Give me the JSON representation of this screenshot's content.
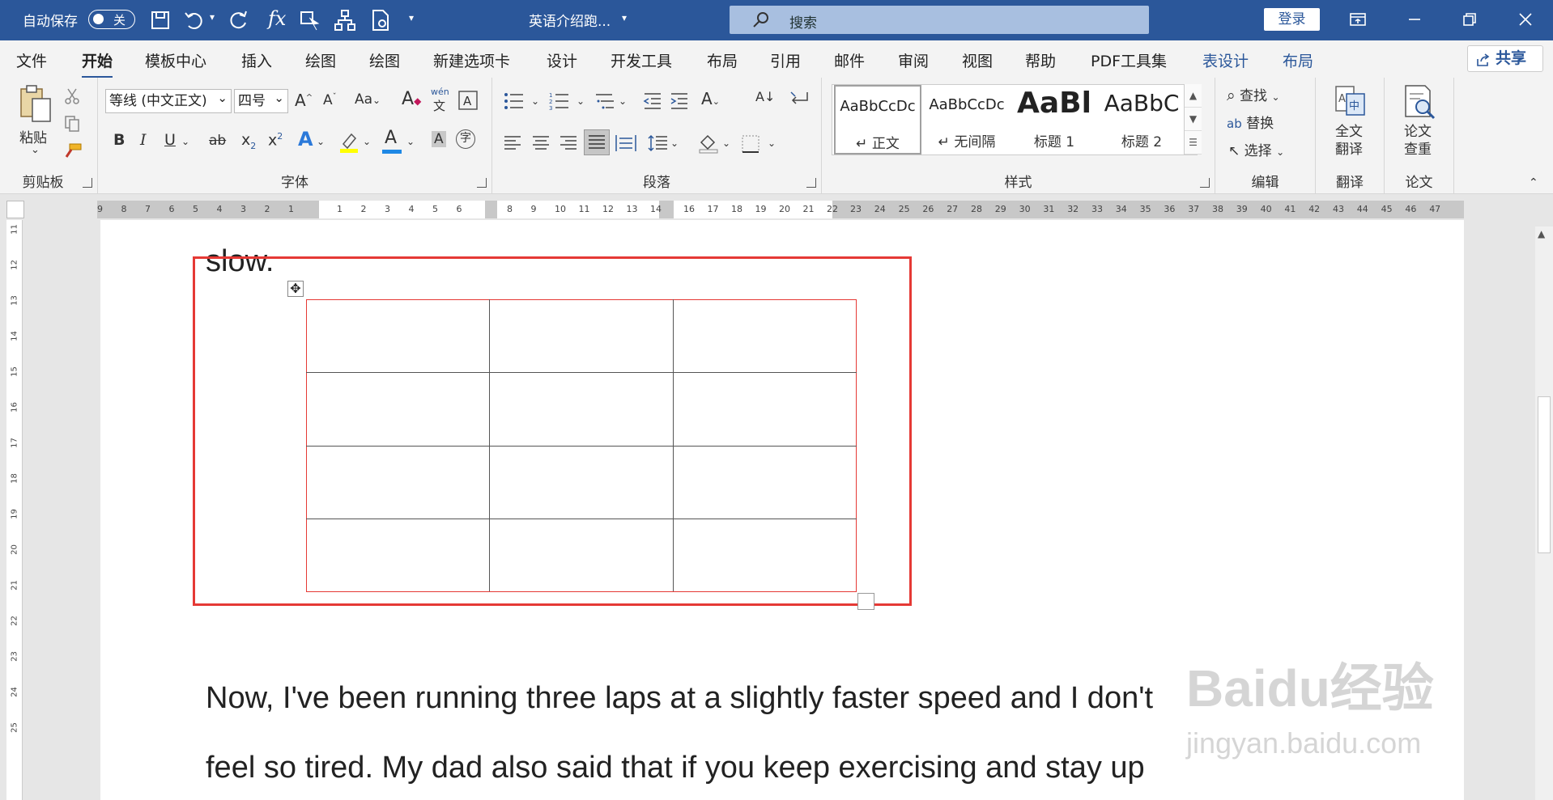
{
  "titlebar": {
    "autosave_label": "自动保存",
    "autosave_state": "关",
    "doc_title": "英语介绍跑...",
    "search_placeholder": "搜索",
    "login": "登录"
  },
  "tabs": [
    "文件",
    "开始",
    "模板中心",
    "插入",
    "绘图",
    "绘图",
    "新建选项卡",
    "设计",
    "开发工具",
    "布局",
    "引用",
    "邮件",
    "审阅",
    "视图",
    "帮助",
    "PDF工具集",
    "表设计",
    "布局"
  ],
  "active_tab": "开始",
  "share_label": "共享",
  "ribbon": {
    "clipboard": {
      "paste": "粘贴",
      "group": "剪贴板"
    },
    "font": {
      "name": "等线 (中文正文)",
      "size": "四号",
      "case": "Aa",
      "wen": "wén",
      "wen_char": "文",
      "bold": "B",
      "italic": "I",
      "underline": "U",
      "strike": "ab",
      "sub": "x",
      "sub_mark": "2",
      "sup": "x",
      "sup_mark": "2",
      "font_a": "A",
      "shade_a": "A",
      "circle_char": "字",
      "group": "字体"
    },
    "paragraph": {
      "group": "段落"
    },
    "styles": {
      "items": [
        {
          "preview": "AaBbCcDc",
          "name": "↵ 正文"
        },
        {
          "preview": "AaBbCcDc",
          "name": "↵ 无间隔"
        },
        {
          "preview": "AaBl",
          "name": "标题 1"
        },
        {
          "preview": "AaBbC",
          "name": "标题 2"
        }
      ],
      "group": "样式"
    },
    "editing": {
      "find": "查找",
      "replace": "替换",
      "select": "选择",
      "group": "编辑"
    },
    "translate": {
      "btn_line1": "全文",
      "btn_line2": "翻译",
      "group": "翻译"
    },
    "paper": {
      "btn_line1": "论文",
      "btn_line2": "查重",
      "group": "论文"
    }
  },
  "ruler_numbers": {
    "left": [
      "9",
      "8",
      "7",
      "6",
      "5",
      "4",
      "3",
      "2",
      "1"
    ],
    "mid": [
      "1",
      "2",
      "3",
      "4",
      "5",
      "6",
      "8",
      "9",
      "10",
      "11",
      "12",
      "13",
      "14",
      "16",
      "17",
      "18",
      "19",
      "20",
      "21",
      "22"
    ],
    "right": [
      "23",
      "24",
      "25",
      "26",
      "27",
      "28",
      "29",
      "30",
      "31",
      "32",
      "33",
      "34",
      "35",
      "36",
      "37",
      "38",
      "39",
      "40",
      "41",
      "42",
      "43",
      "44",
      "45",
      "46",
      "47"
    ],
    "vertical": [
      "11",
      "12",
      "13",
      "14",
      "15",
      "16",
      "17",
      "18",
      "19",
      "20",
      "21",
      "22",
      "23",
      "24",
      "25"
    ]
  },
  "document": {
    "line_above": "slow.",
    "para_line1": "Now, I've been running three laps at a slightly faster speed and I don't",
    "para_line2": "feel so tired. My dad also said that if you keep exercising and stay up"
  },
  "watermark": {
    "brand": "Baidu经验",
    "url": "jingyan.baidu.com"
  },
  "table": {
    "rows": 4,
    "cols": 3
  },
  "colors": {
    "title_bar": "#2b579a",
    "frame": "#e53935",
    "table_border": "#555555"
  }
}
